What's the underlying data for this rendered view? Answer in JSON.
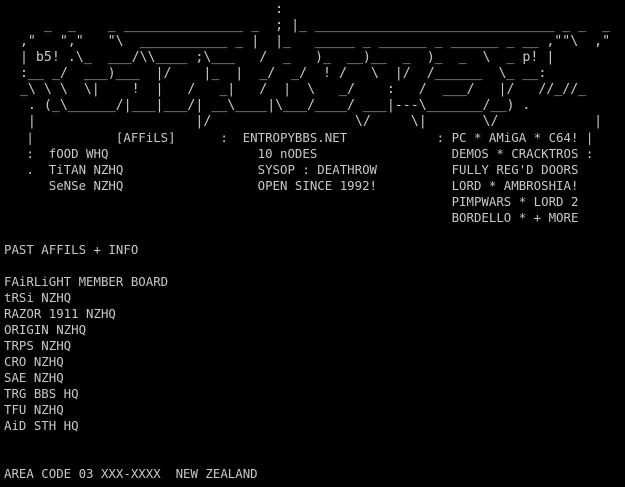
{
  "terminal": {
    "background_color": "#000000",
    "text_color": "#c8c8c8",
    "header_art_lines": [
      "                                  :",
      "     _  _    _ _______________ _  ; |_ ______________________________ _ _  _",
      "  ,\"   \",\"   \"\\  ___________ _ |  |_   _____ _ ______ _ ______ _ __ ,\"\"\\  ,\"",
      "  | b5! .\\_  ___/\\\\____ ;\\___   /  _   )_  __)__  _  )_  _  \\  _ p! |",
      "  :__ _/  ___)___  |/    |_  |  _/  _/  ! /   \\  |/  /______  \\_ __:",
      "  _\\ \\ \\  \\|    !  |   /   _|   /  |  \\   _/    :   /  ___/   |/   //_//_",
      "   . (_\\______/|___|___/| __\\____|\\___/____/ ___|---\\_______/__) .",
      "   |                    |/                  \\/     \\|       \\/            |"
    ],
    "info_lines": [
      "   |           [AFFiLS]      :  ENTROPYBBS.NET            : PC * AMiGA * C64! |",
      "   :  fOOD WHQ                    10 nODES                  DEMOS * CRACKTROS :",
      "   .  TiTAN NZHQ                  SYSOP : DEATHROW          FULLY REG'D DOORS",
      "      SeNSe NZHQ                  OPEN SINCE 1992!          LORD * AMBROSHIA!",
      "                                                            PIMPWARS * LORD 2",
      "                                                            BORDELLO * + MORE"
    ],
    "past_affils_heading": "PAST AFFILS + INFO",
    "past_affils": [
      "FAiRLiGHT MEMBER BOARD",
      "tRSi NZHQ",
      "RAZOR 1911 NZHQ",
      "ORIGIN NZHQ",
      "TRPS NZHQ",
      "CRO NZHQ",
      "SAE NZHQ",
      "TRG BBS HQ",
      "TFU NZHQ",
      "AiD STH HQ"
    ],
    "footer_line": "AREA CODE 03 XXX-XXXX  NEW ZEALAND"
  }
}
